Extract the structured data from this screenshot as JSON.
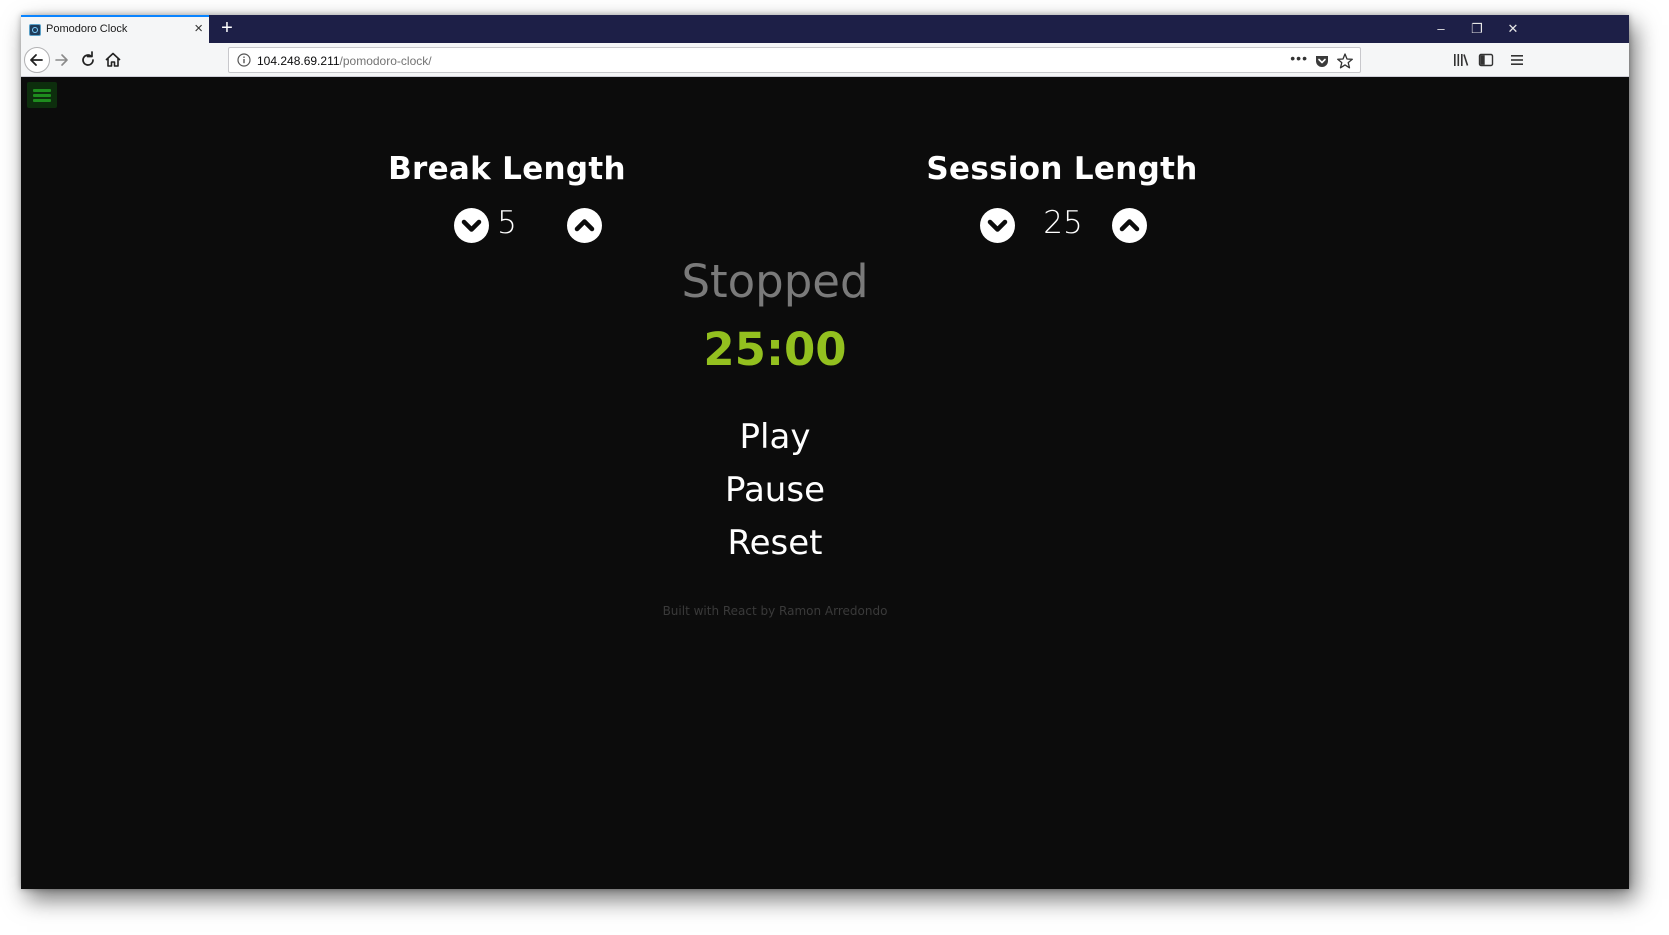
{
  "browser": {
    "tab_title": "Pomodoro Clock",
    "tab_close": "×",
    "new_tab": "+",
    "window_controls": {
      "minimize": "–",
      "restore": "❐",
      "close": "✕"
    },
    "url_host": "104.248.69.211",
    "url_path": "/pomodoro-clock/",
    "url_more": "•••"
  },
  "app": {
    "break": {
      "title": "Break Length",
      "value": "5"
    },
    "session": {
      "title": "Session Length",
      "value": "25"
    },
    "status": "Stopped",
    "timer": "25:00",
    "controls": {
      "play": "Play",
      "pause": "Pause",
      "reset": "Reset"
    },
    "footer": "Built with React by Ramon Arredondo"
  },
  "colors": {
    "background": "#0c0c0c",
    "timer": "#93c01f",
    "status": "#7a7a7a",
    "menu_accent": "#1e8c1e"
  },
  "icons": [
    "info-icon",
    "pocket-icon",
    "bookmark-star-icon",
    "library-icon",
    "sidebar-icon",
    "menu-icon",
    "chevron-down-icon",
    "chevron-up-icon",
    "hamburger-icon"
  ]
}
